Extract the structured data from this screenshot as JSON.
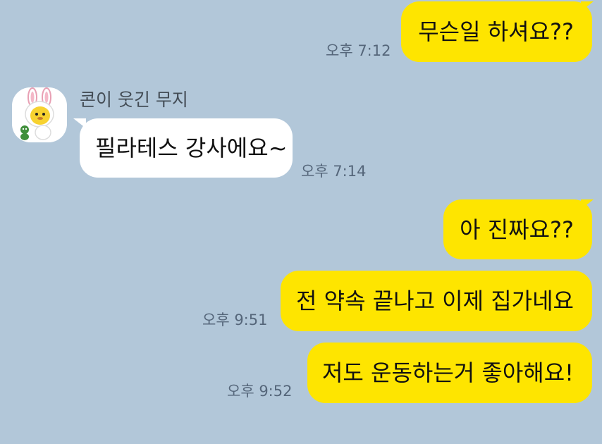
{
  "sender": {
    "name": "콘이 웃긴 무지",
    "avatar_icon": "muzi-rabbit-avatar-icon"
  },
  "colors": {
    "background": "#b2c7d9",
    "my_bubble": "#fee500",
    "their_bubble": "#ffffff",
    "timestamp": "#55667a"
  },
  "messages": [
    {
      "from": "me",
      "text": "무슨일 하셔요??",
      "time": "오후 7:12"
    },
    {
      "from": "other",
      "text": "필라테스 강사에요~",
      "time": "오후 7:14"
    },
    {
      "from": "me",
      "text": "아 진짜요??",
      "time": ""
    },
    {
      "from": "me",
      "text": "전 약속 끝나고 이제 집가네요",
      "time": "오후 9:51"
    },
    {
      "from": "me",
      "text": "저도 운동하는거 좋아해요!",
      "time": "오후 9:52"
    }
  ]
}
